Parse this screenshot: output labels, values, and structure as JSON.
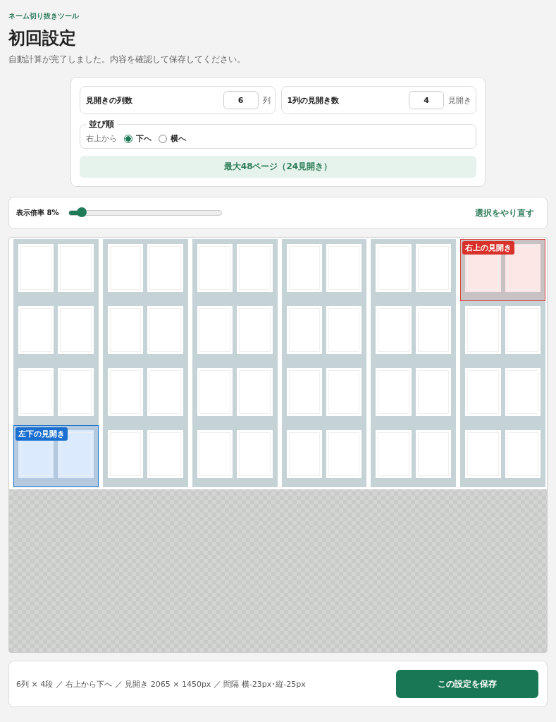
{
  "app_name": "ネーム切り抜きツール",
  "title": "初回設定",
  "subtitle": "自動計算が完了しました。内容を確認して保存してください。",
  "settings": {
    "fields": [
      {
        "label": "見開きの列数",
        "value": "6",
        "unit": "列"
      },
      {
        "label": "1列の見開き数",
        "value": "4",
        "unit": "見開き"
      }
    ],
    "order": {
      "legend": "並び順",
      "prefix": "右上から",
      "options": [
        {
          "label": "下へ",
          "selected": true
        },
        {
          "label": "横へ",
          "selected": false
        }
      ]
    },
    "summary": "最大48ページ（24見開き）"
  },
  "zoom": {
    "label": "表示倍率 8%",
    "level": 0.08,
    "reset_link": "選択をやり直す"
  },
  "preview": {
    "markers": [
      {
        "kind": "top_right",
        "label": "右上の見開き"
      },
      {
        "kind": "bottom_left",
        "label": "左下の見開き"
      }
    ]
  },
  "footer": {
    "summary": "6列 × 4段 ／ 右上から下へ ／ 見開き 2065 × 1450px ／ 間隔 横-23px･縦-25px",
    "save_button": "この設定を保存"
  }
}
